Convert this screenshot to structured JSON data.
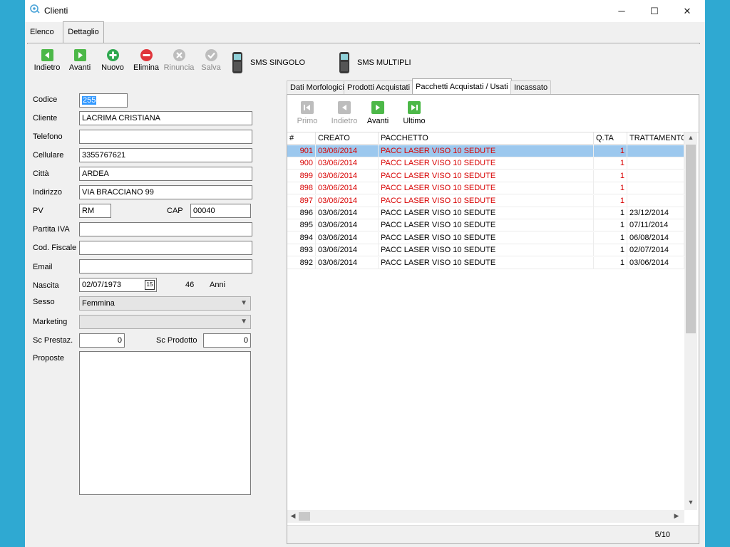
{
  "window": {
    "title": "Clienti",
    "controls": {
      "minimize": "─",
      "maximize": "☐",
      "close": "✕"
    }
  },
  "view_tabs": {
    "elenco": "Elenco",
    "dettaglio": "Dettaglio",
    "active": "Dettaglio"
  },
  "toolbar": {
    "indietro": "Indietro",
    "avanti": "Avanti",
    "nuovo": "Nuovo",
    "elimina": "Elimina",
    "rinuncia": "Rinuncia",
    "salva": "Salva",
    "sms_singolo": "SMS SINGOLO",
    "sms_multipli": "SMS MULTIPLI"
  },
  "form": {
    "codice": {
      "label": "Codice",
      "value": "255"
    },
    "cliente": {
      "label": "Cliente",
      "value": "LACRIMA CRISTIANA"
    },
    "telefono": {
      "label": "Telefono",
      "value": ""
    },
    "cellulare": {
      "label": "Cellulare",
      "value": "3355767621"
    },
    "citta": {
      "label": "Città",
      "value": "ARDEA"
    },
    "indirizzo": {
      "label": "Indirizzo",
      "value": "VIA BRACCIANO 99"
    },
    "pv": {
      "label": "PV",
      "value": "RM"
    },
    "cap": {
      "label": "CAP",
      "value": "00040"
    },
    "partita_iva": {
      "label": "Partita IVA",
      "value": ""
    },
    "cod_fiscale": {
      "label": "Cod. Fiscale",
      "value": ""
    },
    "email": {
      "label": "Email",
      "value": ""
    },
    "nascita": {
      "label": "Nascita",
      "value": "02/07/1973",
      "calendar_glyph": "15"
    },
    "eta": {
      "value": "46",
      "unit": "Anni"
    },
    "sesso": {
      "label": "Sesso",
      "value": "Femmina"
    },
    "marketing": {
      "label": "Marketing",
      "value": ""
    },
    "sc_prestaz": {
      "label": "Sc Prestaz.",
      "value": "0"
    },
    "sc_prodotto": {
      "label": "Sc Prodotto",
      "value": "0"
    },
    "proposte": {
      "label": "Proposte",
      "value": ""
    }
  },
  "detail_tabs": {
    "dati_morfologici": "Dati Morfologici",
    "prodotti_acquistati": "Prodotti Acquistati",
    "pacchetti": "Pacchetti Acquistati / Usati",
    "incassato": "Incassato",
    "active": "Pacchetti Acquistati / Usati"
  },
  "navbar": {
    "primo": "Primo",
    "indietro": "Indietro",
    "avanti": "Avanti",
    "ultimo": "Ultimo"
  },
  "grid": {
    "columns": {
      "num": "#",
      "creato": "CREATO",
      "pacchetto": "PACCHETTO",
      "qta": "Q.TA",
      "trattamento": "TRATTAMENTO"
    },
    "rows": [
      {
        "num": "901",
        "creato": "03/06/2014",
        "pacchetto": "PACC LASER VISO 10 SEDUTE",
        "qta": "1",
        "trattamento": "",
        "style": "red",
        "selected": true
      },
      {
        "num": "900",
        "creato": "03/06/2014",
        "pacchetto": "PACC LASER VISO 10 SEDUTE",
        "qta": "1",
        "trattamento": "",
        "style": "red",
        "selected": false
      },
      {
        "num": "899",
        "creato": "03/06/2014",
        "pacchetto": "PACC LASER VISO 10 SEDUTE",
        "qta": "1",
        "trattamento": "",
        "style": "red",
        "selected": false
      },
      {
        "num": "898",
        "creato": "03/06/2014",
        "pacchetto": "PACC LASER VISO 10 SEDUTE",
        "qta": "1",
        "trattamento": "",
        "style": "red",
        "selected": false
      },
      {
        "num": "897",
        "creato": "03/06/2014",
        "pacchetto": "PACC LASER VISO 10 SEDUTE",
        "qta": "1",
        "trattamento": "",
        "style": "red",
        "selected": false
      },
      {
        "num": "896",
        "creato": "03/06/2014",
        "pacchetto": "PACC LASER VISO 10 SEDUTE",
        "qta": "1",
        "trattamento": "23/12/2014",
        "style": "normal",
        "selected": false
      },
      {
        "num": "895",
        "creato": "03/06/2014",
        "pacchetto": "PACC LASER VISO 10 SEDUTE",
        "qta": "1",
        "trattamento": "07/11/2014",
        "style": "normal",
        "selected": false
      },
      {
        "num": "894",
        "creato": "03/06/2014",
        "pacchetto": "PACC LASER VISO 10 SEDUTE",
        "qta": "1",
        "trattamento": "06/08/2014",
        "style": "normal",
        "selected": false
      },
      {
        "num": "893",
        "creato": "03/06/2014",
        "pacchetto": "PACC LASER VISO 10 SEDUTE",
        "qta": "1",
        "trattamento": "02/07/2014",
        "style": "normal",
        "selected": false
      },
      {
        "num": "892",
        "creato": "03/06/2014",
        "pacchetto": "PACC LASER VISO 10 SEDUTE",
        "qta": "1",
        "trattamento": "03/06/2014",
        "style": "normal",
        "selected": false
      }
    ]
  },
  "status": {
    "record_position": "5/10"
  },
  "colors": {
    "nav_green": "#4cb848",
    "add_green": "#2fa84f",
    "delete_red": "#e0363c",
    "disabled_gray": "#bdbdbd",
    "row_red_text": "#d80000",
    "selection_blue": "#9cc8ee",
    "desktop_blue": "#2fa9d2"
  },
  "icons": {
    "back": "back-arrow-icon",
    "forward": "forward-arrow-icon",
    "add": "plus-circle-icon",
    "delete": "minus-circle-icon",
    "cancel": "x-circle-icon",
    "save": "check-circle-icon",
    "sms": "mobile-phone-icon",
    "first": "first-record-icon",
    "last": "last-record-icon"
  }
}
